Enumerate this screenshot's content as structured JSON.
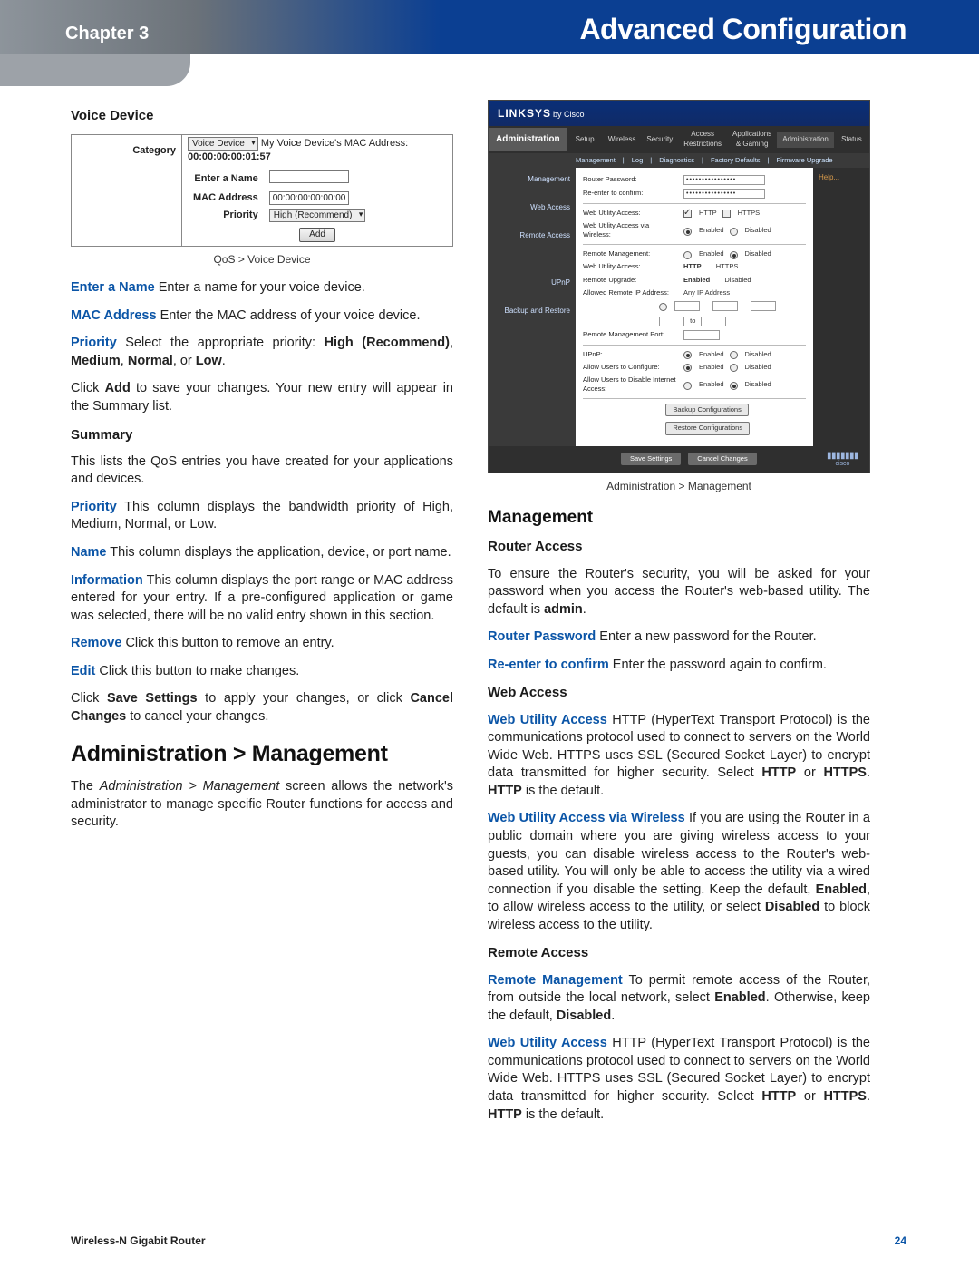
{
  "header": {
    "chapter": "Chapter 3",
    "title": "Advanced Configuration"
  },
  "footer": {
    "product": "Wireless-N Gigabit Router",
    "page": "24"
  },
  "left": {
    "h_vd": "Voice Device",
    "vd_table": {
      "category_label": "Category",
      "category_value": "Voice Device",
      "mac_desc": "My Voice Device's MAC Address:",
      "mac_desc_value": "00:00:00:00:01:57",
      "name_label": "Enter a Name",
      "mac_label": "MAC Address",
      "mac_value": "00:00:00:00:00:00",
      "priority_label": "Priority",
      "priority_value": "High (Recommend)",
      "add_btn": "Add"
    },
    "cap1": "QoS > Voice Device",
    "p_enter": {
      "lead": "Enter a Name",
      "rest": "  Enter a name for your voice device."
    },
    "p_mac": {
      "lead": "MAC Address",
      "rest": " Enter the MAC address of your voice device."
    },
    "p_pri": {
      "lead": "Priority",
      "rest": " Select the appropriate priority: ",
      "b1": "High (Recommend)",
      "s1": ", ",
      "b2": "Medium",
      "s2": ", ",
      "b3": "Normal",
      "s3": ", or ",
      "b4": "Low",
      "s4": "."
    },
    "p_add": {
      "pre": "Click ",
      "b1": "Add",
      "rest": " to save your changes. Your new entry will appear in the Summary list."
    },
    "h_sum": "Summary",
    "p_sum": "This lists the QoS entries you have created for your applications and devices.",
    "p_pricol": {
      "lead": "Priority",
      "rest": "  This column displays the bandwidth priority of High, Medium, Normal, or Low."
    },
    "p_namecol": {
      "lead": "Name",
      "rest": "  This column displays the application, device, or port name."
    },
    "p_infocol": {
      "lead": "Information",
      "rest": "  This column displays the port range or MAC address entered for your entry. If a pre-configured application or game was selected, there will be no valid entry shown in this section."
    },
    "p_remove": {
      "lead": "Remove",
      "rest": "  Click this button to remove an entry."
    },
    "p_edit": {
      "lead": "Edit",
      "rest": "  Click this button to make changes."
    },
    "p_save": {
      "pre": "Click ",
      "b1": "Save Settings",
      "mid": " to apply your changes, or click ",
      "b2": "Cancel Changes",
      "rest": " to cancel your changes."
    },
    "h_admin": "Administration > Management",
    "p_admin": {
      "pre": "The ",
      "i1": "Administration > Management",
      "rest": " screen allows the network's administrator to manage specific Router functions for access and security."
    }
  },
  "right": {
    "ss": {
      "brand_a": "LINKSYS",
      "brand_b": "by Cisco",
      "section": "Administration",
      "tabs": [
        "Setup",
        "Wireless",
        "Security",
        "Access Restrictions",
        "Applications & Gaming",
        "Administration",
        "Status"
      ],
      "subtabs": [
        "Management",
        "Log",
        "Diagnostics",
        "Factory Defaults",
        "Firmware Upgrade"
      ],
      "groups": [
        "Management",
        "Web Access",
        "Remote Access",
        "UPnP",
        "Backup and Restore"
      ],
      "help": "Help...",
      "rows": {
        "rp": "Router Password:",
        "rp_v": "••••••••••••••••",
        "re": "Re-enter to confirm:",
        "re_v": "••••••••••••••••",
        "wua": "Web Utility Access:",
        "http": "HTTP",
        "https": "HTTPS",
        "wuaw": "Web Utility Access via Wireless:",
        "en": "Enabled",
        "dis": "Disabled",
        "rm": "Remote Management:",
        "wua2": "Web Utility Access:",
        "http2": "HTTP",
        "https2": "HTTPS",
        "ru": "Remote Upgrade:",
        "ari": "Allowed Remote IP Address:",
        "anyip": "Any IP Address",
        "rmp": "Remote Management Port:",
        "upnp": "UPnP:",
        "aluc": "Allow Users to Configure:",
        "aldi": "Allow Users to Disable Internet Access:"
      },
      "btn_backup": "Backup Configurations",
      "btn_restore": "Restore Configurations",
      "btn_save": "Save Settings",
      "btn_cancel": "Cancel Changes",
      "cisco": "cisco"
    },
    "cap2": "Administration > Management",
    "h_mgmt": "Management",
    "h_ra": "Router Access",
    "p_ra": {
      "pre": "To ensure the Router's security, you will be asked for your password when you access the Router's web-based utility. The default is ",
      "b1": "admin",
      "post": "."
    },
    "p_rpw": {
      "lead": "Router Password",
      "rest": "  Enter a new password for the Router."
    },
    "p_recon": {
      "lead": "Re-enter to confirm",
      "rest": " Enter the password again to confirm."
    },
    "h_wa": "Web Access",
    "p_wua": {
      "lead": "Web Utility Access",
      "rest": "  HTTP (HyperText Transport Protocol) is the communications protocol used to connect to servers on the World Wide Web. HTTPS uses SSL (Secured Socket Layer) to encrypt data transmitted for higher security. Select ",
      "b1": "HTTP",
      "mid": " or ",
      "b2": "HTTPS",
      "post1": ". ",
      "b3": "HTTP",
      "post2": " is the default."
    },
    "p_wuaw": {
      "lead": "Web Utility Access via Wireless",
      "rest": " If you are using the Router in a public domain where you are giving wireless access to your guests, you can disable wireless access to the Router's web-based utility. You will only be able to access the utility via a wired connection if you disable the setting. Keep the default, ",
      "b1": "Enabled",
      "mid": ", to allow wireless access to the utility, or select ",
      "b2": "Disabled",
      "post": " to block wireless access to the utility."
    },
    "h_rem": "Remote Access",
    "p_rmgmt": {
      "lead": "Remote Management",
      "rest": "  To permit remote access of the Router, from outside the local network, select ",
      "b1": "Enabled",
      "mid": ". Otherwise, keep the default, ",
      "b2": "Disabled",
      "post": "."
    },
    "p_wua2": {
      "lead": "Web Utility Access",
      "rest": "  HTTP (HyperText Transport Protocol) is the communications protocol used to connect to servers on the World Wide Web. HTTPS uses SSL (Secured Socket Layer) to encrypt data transmitted for higher security. Select ",
      "b1": "HTTP",
      "mid": " or ",
      "b2": "HTTPS",
      "post1": ". ",
      "b3": "HTTP",
      "post2": " is the default."
    }
  }
}
